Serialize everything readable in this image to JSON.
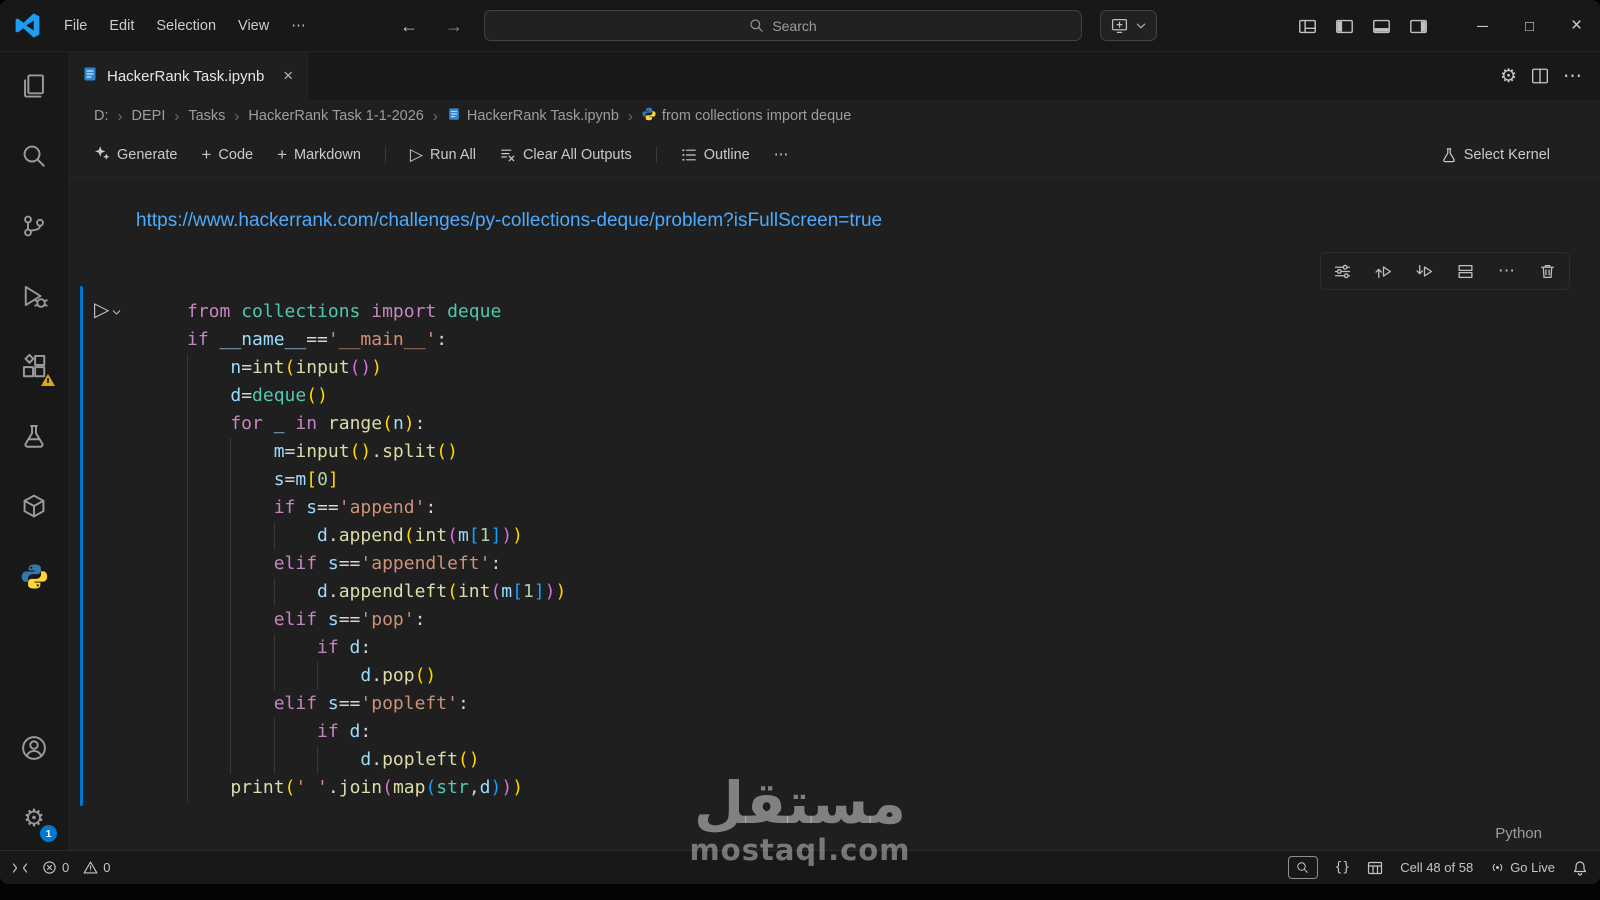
{
  "titlebar": {
    "menus": [
      "File",
      "Edit",
      "Selection",
      "View"
    ],
    "search_label": "Search"
  },
  "glyphs": {
    "more": "⋯",
    "back": "←",
    "forward": "→",
    "plus": "+",
    "play": "▷",
    "minimize": "─",
    "maximize": "□",
    "close": "×",
    "braces": "{}",
    "gear": "⚙",
    "crumb_sep": "›"
  },
  "tab": {
    "title": "HackerRank Task.ipynb"
  },
  "breadcrumb": {
    "items": [
      "D:",
      "DEPI",
      "Tasks",
      "HackerRank Task 1-1-2026",
      "HackerRank Task.ipynb",
      "from collections import deque"
    ]
  },
  "notebook_toolbar": {
    "generate": "Generate",
    "add_code": "Code",
    "add_markdown": "Markdown",
    "run_all": "Run All",
    "clear_outputs": "Clear All Outputs",
    "outline": "Outline",
    "select_kernel": "Select Kernel"
  },
  "markdown_cell": {
    "link_text": "https://www.hackerrank.com/challenges/py-collections-deque/problem?isFullScreen=true"
  },
  "code_cell": {
    "language_label": "Python",
    "lines": [
      {
        "ind": 0,
        "toks": [
          [
            "k",
            "from "
          ],
          [
            "c",
            "collections "
          ],
          [
            "k",
            "import "
          ],
          [
            "c",
            "deque"
          ]
        ]
      },
      {
        "ind": 0,
        "toks": [
          [
            "k",
            "if "
          ],
          [
            "v",
            "__name__"
          ],
          [
            "p",
            "=="
          ],
          [
            "s",
            "'__main__'"
          ],
          [
            "p",
            ":"
          ]
        ]
      },
      {
        "ind": 1,
        "toks": [
          [
            "v",
            "n"
          ],
          [
            "p",
            "="
          ],
          [
            "f",
            "int"
          ],
          [
            "b1",
            "("
          ],
          [
            "f",
            "input"
          ],
          [
            "b2",
            "("
          ],
          [
            "b2",
            ")"
          ],
          [
            "b1",
            ")"
          ]
        ]
      },
      {
        "ind": 1,
        "toks": [
          [
            "v",
            "d"
          ],
          [
            "p",
            "="
          ],
          [
            "c",
            "deque"
          ],
          [
            "b1",
            "("
          ],
          [
            "b1",
            ")"
          ]
        ]
      },
      {
        "ind": 1,
        "toks": [
          [
            "k",
            "for "
          ],
          [
            "v",
            "_ "
          ],
          [
            "k",
            "in "
          ],
          [
            "f",
            "range"
          ],
          [
            "b1",
            "("
          ],
          [
            "v",
            "n"
          ],
          [
            "b1",
            ")"
          ],
          [
            "p",
            ":"
          ]
        ]
      },
      {
        "ind": 2,
        "toks": [
          [
            "v",
            "m"
          ],
          [
            "p",
            "="
          ],
          [
            "f",
            "input"
          ],
          [
            "b1",
            "("
          ],
          [
            "b1",
            ")"
          ],
          [
            "p",
            "."
          ],
          [
            "f",
            "split"
          ],
          [
            "b1",
            "("
          ],
          [
            "b1",
            ")"
          ]
        ]
      },
      {
        "ind": 2,
        "toks": [
          [
            "v",
            "s"
          ],
          [
            "p",
            "="
          ],
          [
            "v",
            "m"
          ],
          [
            "b1",
            "["
          ],
          [
            "n",
            "0"
          ],
          [
            "b1",
            "]"
          ]
        ]
      },
      {
        "ind": 2,
        "toks": [
          [
            "k",
            "if "
          ],
          [
            "v",
            "s"
          ],
          [
            "p",
            "=="
          ],
          [
            "s",
            "'append'"
          ],
          [
            "p",
            ":"
          ]
        ]
      },
      {
        "ind": 3,
        "toks": [
          [
            "v",
            "d"
          ],
          [
            "p",
            "."
          ],
          [
            "f",
            "append"
          ],
          [
            "b1",
            "("
          ],
          [
            "f",
            "int"
          ],
          [
            "b2",
            "("
          ],
          [
            "v",
            "m"
          ],
          [
            "b3",
            "["
          ],
          [
            "n",
            "1"
          ],
          [
            "b3",
            "]"
          ],
          [
            "b2",
            ")"
          ],
          [
            "b1",
            ")"
          ]
        ]
      },
      {
        "ind": 2,
        "toks": [
          [
            "k",
            "elif "
          ],
          [
            "v",
            "s"
          ],
          [
            "p",
            "=="
          ],
          [
            "s",
            "'appendleft'"
          ],
          [
            "p",
            ":"
          ]
        ]
      },
      {
        "ind": 3,
        "toks": [
          [
            "v",
            "d"
          ],
          [
            "p",
            "."
          ],
          [
            "f",
            "appendleft"
          ],
          [
            "b1",
            "("
          ],
          [
            "f",
            "int"
          ],
          [
            "b2",
            "("
          ],
          [
            "v",
            "m"
          ],
          [
            "b3",
            "["
          ],
          [
            "n",
            "1"
          ],
          [
            "b3",
            "]"
          ],
          [
            "b2",
            ")"
          ],
          [
            "b1",
            ")"
          ]
        ]
      },
      {
        "ind": 2,
        "toks": [
          [
            "k",
            "elif "
          ],
          [
            "v",
            "s"
          ],
          [
            "p",
            "=="
          ],
          [
            "s",
            "'pop'"
          ],
          [
            "p",
            ":"
          ]
        ]
      },
      {
        "ind": 3,
        "toks": [
          [
            "k",
            "if "
          ],
          [
            "v",
            "d"
          ],
          [
            "p",
            ":"
          ]
        ]
      },
      {
        "ind": 4,
        "toks": [
          [
            "v",
            "d"
          ],
          [
            "p",
            "."
          ],
          [
            "f",
            "pop"
          ],
          [
            "b1",
            "("
          ],
          [
            "b1",
            ")"
          ]
        ]
      },
      {
        "ind": 2,
        "toks": [
          [
            "k",
            "elif "
          ],
          [
            "v",
            "s"
          ],
          [
            "p",
            "=="
          ],
          [
            "s",
            "'popleft'"
          ],
          [
            "p",
            ":"
          ]
        ]
      },
      {
        "ind": 3,
        "toks": [
          [
            "k",
            "if "
          ],
          [
            "v",
            "d"
          ],
          [
            "p",
            ":"
          ]
        ]
      },
      {
        "ind": 4,
        "toks": [
          [
            "v",
            "d"
          ],
          [
            "p",
            "."
          ],
          [
            "f",
            "popleft"
          ],
          [
            "b1",
            "("
          ],
          [
            "b1",
            ")"
          ]
        ]
      },
      {
        "ind": 1,
        "toks": [
          [
            "f",
            "print"
          ],
          [
            "b1",
            "("
          ],
          [
            "s",
            "' '"
          ],
          [
            "p",
            "."
          ],
          [
            "f",
            "join"
          ],
          [
            "b2",
            "("
          ],
          [
            "f",
            "map"
          ],
          [
            "b3",
            "("
          ],
          [
            "c",
            "str"
          ],
          [
            "p",
            ","
          ],
          [
            "v",
            "d"
          ],
          [
            "b3",
            ")"
          ],
          [
            "b2",
            ")"
          ],
          [
            "b1",
            ")"
          ]
        ]
      }
    ]
  },
  "activity_bar": {
    "settings_badge": "1"
  },
  "statusbar": {
    "errors": "0",
    "warnings": "0",
    "cell_position": "Cell 48 of 58",
    "go_live": "Go Live"
  },
  "watermark": {
    "line1": "مستقل",
    "line2": "mostaql.com"
  },
  "colors": {
    "accent": "#0078d4",
    "link": "#4daafc",
    "keyword": "#c586c0",
    "class": "#4ec9b0",
    "function": "#dcdcaa",
    "variable": "#9cdcfe",
    "string": "#ce9178",
    "number": "#b5cea8",
    "punctuation": "#d4d4d4",
    "bracket1": "#ffd700",
    "bracket2": "#da70d6",
    "bracket3": "#179fff"
  }
}
